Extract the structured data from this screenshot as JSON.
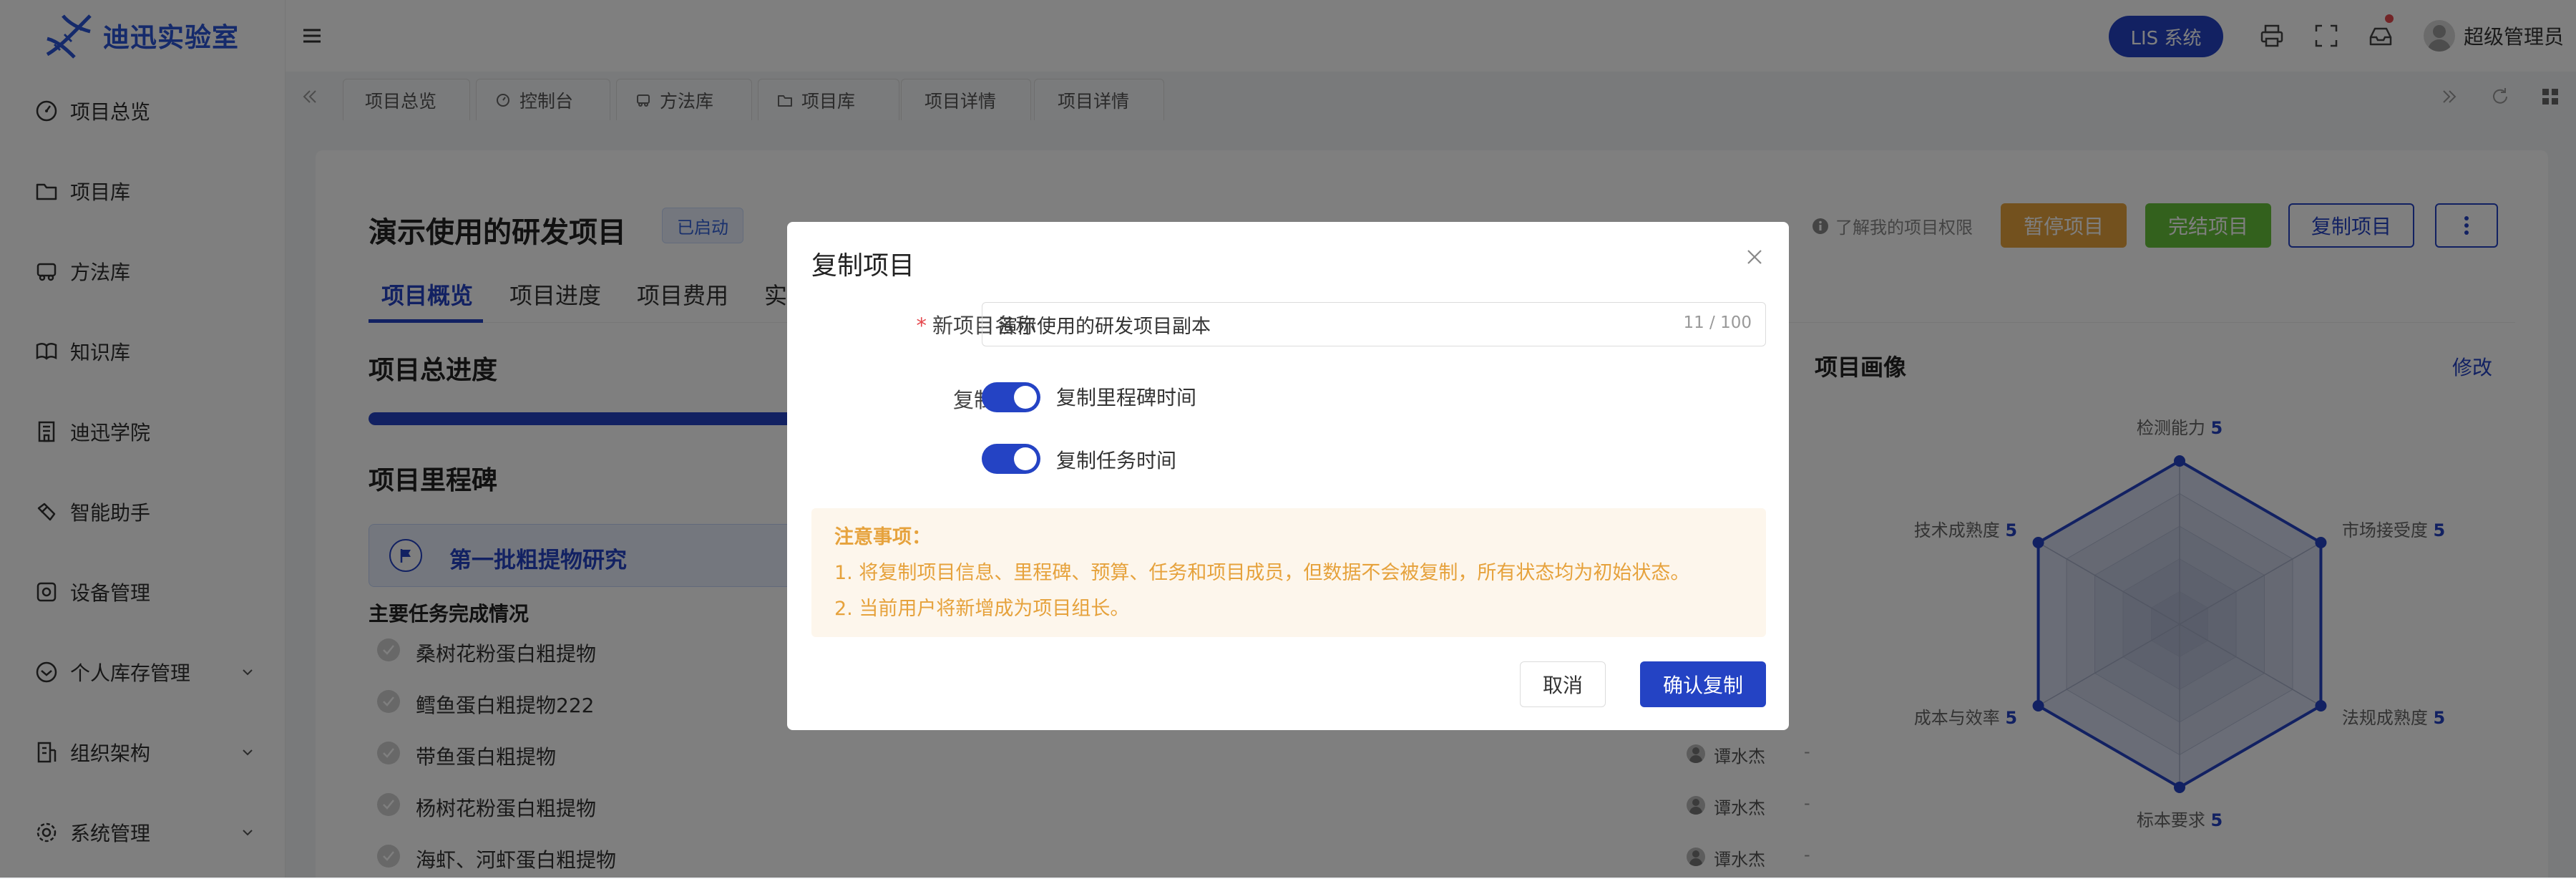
{
  "app": {
    "name": "迪迅实验室"
  },
  "sidebar": {
    "items": [
      {
        "label": "项目总览",
        "icon": "dashboard-icon"
      },
      {
        "label": "项目库",
        "icon": "folder-icon"
      },
      {
        "label": "方法库",
        "icon": "car-icon"
      },
      {
        "label": "知识库",
        "icon": "book-icon"
      },
      {
        "label": "迪迅学院",
        "icon": "building-icon"
      },
      {
        "label": "智能助手",
        "icon": "assistant-icon"
      },
      {
        "label": "设备管理",
        "icon": "device-icon"
      },
      {
        "label": "个人库存管理",
        "icon": "inventory-icon",
        "expandable": true
      },
      {
        "label": "组织架构",
        "icon": "org-icon",
        "expandable": true
      },
      {
        "label": "系统管理",
        "icon": "settings-icon",
        "expandable": true
      }
    ]
  },
  "header": {
    "lis_label": "LIS 系统",
    "user_name": "超级管理员",
    "has_notification": true
  },
  "tabs": [
    {
      "label": "项目总览",
      "icon": ""
    },
    {
      "label": "控制台",
      "icon": "dashboard-icon"
    },
    {
      "label": "方法库",
      "icon": "car-icon"
    },
    {
      "label": "项目库",
      "icon": "folder-icon"
    },
    {
      "label": "项目详情",
      "icon": ""
    },
    {
      "label": "项目详情",
      "icon": ""
    }
  ],
  "project": {
    "title": "演示使用的研发项目",
    "status": "已启动",
    "permission_link": "了解我的项目权限",
    "actions": {
      "pause": "暂停项目",
      "finish": "完结项目",
      "copy": "复制项目"
    },
    "page_tabs": [
      "项目概览",
      "项目进度",
      "项目费用",
      "实"
    ],
    "progress_title": "项目总进度",
    "progress_fraction": 0.83,
    "milestone_title": "项目里程碑",
    "milestone_name": "第一批粗提物研究",
    "tasks_title": "主要任务完成情况",
    "tasks": [
      {
        "name": "桑树花粉蛋白粗提物",
        "owner": "",
        "extra": ""
      },
      {
        "name": "鳕鱼蛋白粗提物222",
        "owner": "",
        "extra": ""
      },
      {
        "name": "带鱼蛋白粗提物",
        "owner": "谭水杰",
        "extra": "-"
      },
      {
        "name": "杨树花粉蛋白粗提物",
        "owner": "谭水杰",
        "extra": "-"
      },
      {
        "name": "海虾、河虾蛋白粗提物",
        "owner": "谭水杰",
        "extra": "-"
      }
    ]
  },
  "portrait": {
    "title": "项目画像",
    "edit_label": "修改"
  },
  "chart_data": {
    "type": "radar",
    "categories": [
      "检测能力",
      "市场接受度",
      "法规成熟度",
      "标本要求",
      "成本与效率",
      "技术成熟度"
    ],
    "values": [
      5,
      5,
      5,
      5,
      5,
      5
    ],
    "max": 5,
    "levels": 5
  },
  "modal": {
    "title": "复制项目",
    "name_label": "新项目名称",
    "name_value": "演示使用的研发项目副本",
    "name_count": "11 / 100",
    "options_label": "复制选项",
    "option1_label": "复制里程碑时间",
    "option1_on": true,
    "option2_label": "复制任务时间",
    "option2_on": true,
    "notice_title": "注意事项：",
    "notice_lines": [
      "1. 将复制项目信息、里程碑、预算、任务和项目成员，但数据不会被复制，所有状态均为初始状态。",
      "2. 当前用户将新增成为项目组长。"
    ],
    "cancel_label": "取消",
    "confirm_label": "确认复制"
  },
  "colors": {
    "primary": "#2443c4",
    "warning": "#e6a23c",
    "success": "#67c23a",
    "notice_bg": "#fdf6ec"
  }
}
